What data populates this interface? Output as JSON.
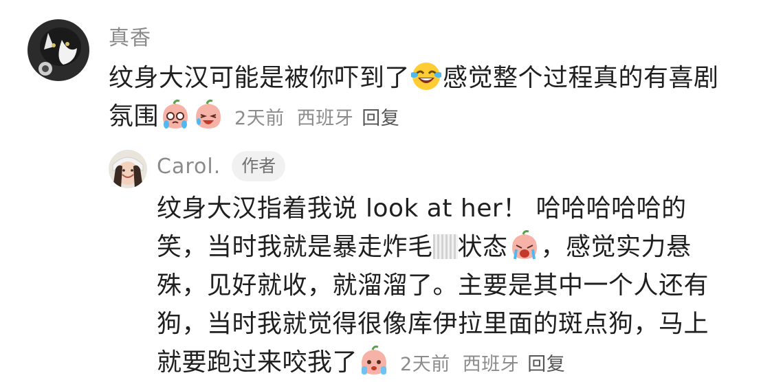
{
  "comments": [
    {
      "author": "真香",
      "is_author": false,
      "avatar_icon": "cat-avatar-icon",
      "content_parts": [
        "纹身大汉可能是被你吓到了",
        "感觉整个过程真的有喜剧氛围"
      ],
      "emojis": [
        "laugh-tears-emoji-icon",
        "crying-peach-emoji-icon",
        "grinning-peach-emoji-icon"
      ],
      "time": "2天前",
      "location": "西班牙",
      "reply_label": "回复"
    },
    {
      "author": "Carol.",
      "is_author": true,
      "author_tag": "作者",
      "avatar_icon": "girl-avatar-icon",
      "content_parts": [
        "纹身大汉指着我说 look at her！ 哈哈哈哈哈的笑，当时我就是暴走炸毛",
        "状态",
        "，感觉实力悬殊，见好就收，就溜溜了。主要是其中一个人还有狗，当时我就觉得很像库伊拉里面的斑点狗，马上就要跑过来咬我了"
      ],
      "emojis": [
        "wailing-peach-emoji-icon",
        "scared-peach-emoji-icon"
      ],
      "time": "2天前",
      "location": "西班牙",
      "reply_label": "回复"
    }
  ],
  "colors": {
    "text": "#1f1f1f",
    "author": "#8a8a8a",
    "meta": "#8c8c8c",
    "tag_bg": "#f1f1f1",
    "peach": "#f7b2a8"
  }
}
